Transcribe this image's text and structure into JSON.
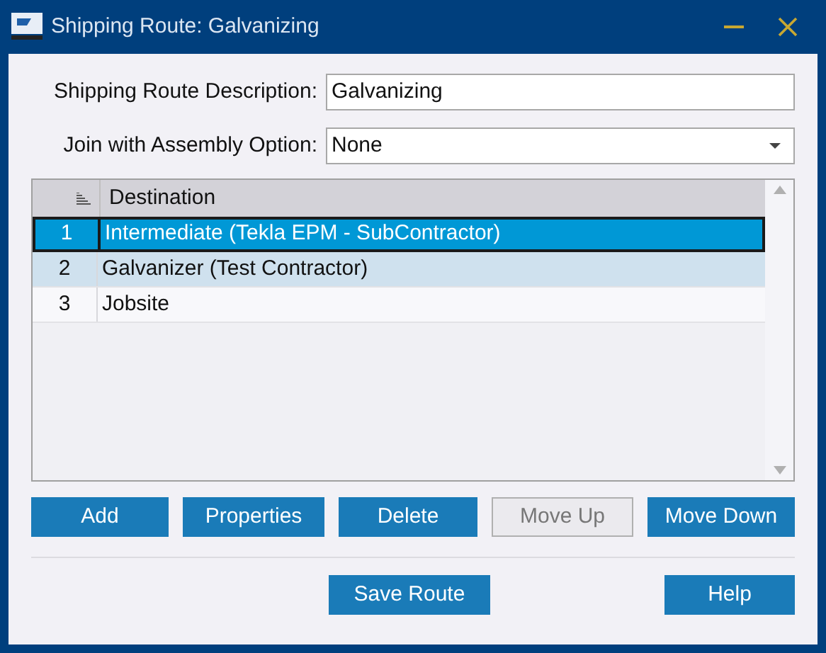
{
  "window": {
    "title": "Shipping Route: Galvanizing"
  },
  "fields": [
    {
      "label": "Shipping Route Description:",
      "kind": "text",
      "value": "Galvanizing"
    },
    {
      "label": "Join with Assembly Option:",
      "kind": "dropdown",
      "value": "None"
    }
  ],
  "table": {
    "columns": [
      "Destination"
    ],
    "rows": [
      {
        "number": "1",
        "destination": "Intermediate (Tekla EPM - SubContractor)",
        "selected": true,
        "highlighted": false
      },
      {
        "number": "2",
        "destination": "Galvanizer (Test Contractor)",
        "selected": false,
        "highlighted": true
      },
      {
        "number": "3",
        "destination": "Jobsite",
        "selected": false,
        "highlighted": false
      }
    ]
  },
  "list_buttons": [
    {
      "label": "Add",
      "disabled": false
    },
    {
      "label": "Properties",
      "disabled": false
    },
    {
      "label": "Delete",
      "disabled": false
    },
    {
      "label": "Move Up",
      "disabled": true
    },
    {
      "label": "Move Down",
      "disabled": false
    }
  ],
  "footer_buttons": [
    {
      "label": "Save Route",
      "disabled": false
    },
    {
      "label": "Help",
      "disabled": false
    }
  ]
}
